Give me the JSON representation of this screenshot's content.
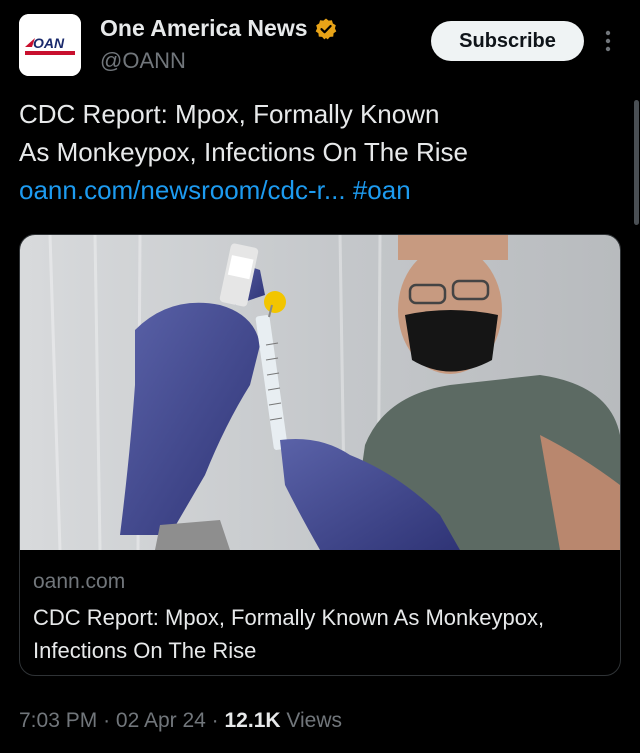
{
  "author": {
    "display_name": "One America News",
    "handle": "@OANN",
    "avatar_label": "OAN",
    "verified_color": "#e8a317"
  },
  "subscribe_label": "Subscribe",
  "more_icon": "more-vertical-icon",
  "tweet": {
    "line1": "CDC Report: Mpox, Formally Known",
    "line2": "As Monkeypox, Infections On The Rise",
    "link_text": "oann.com/newsroom/cdc-r...",
    "hashtag": "#oan"
  },
  "card": {
    "domain": "oann.com",
    "title": "CDC Report: Mpox, Formally Known As Monkeypox, Infections On The Rise"
  },
  "meta": {
    "time": "7:03 PM",
    "date": "02 Apr 24",
    "views_count": "12.1K",
    "views_label": "Views",
    "separator": "·"
  },
  "colors": {
    "background": "#000000",
    "link": "#1d9bf0",
    "muted": "#71767b",
    "text": "#e7e9ea"
  }
}
